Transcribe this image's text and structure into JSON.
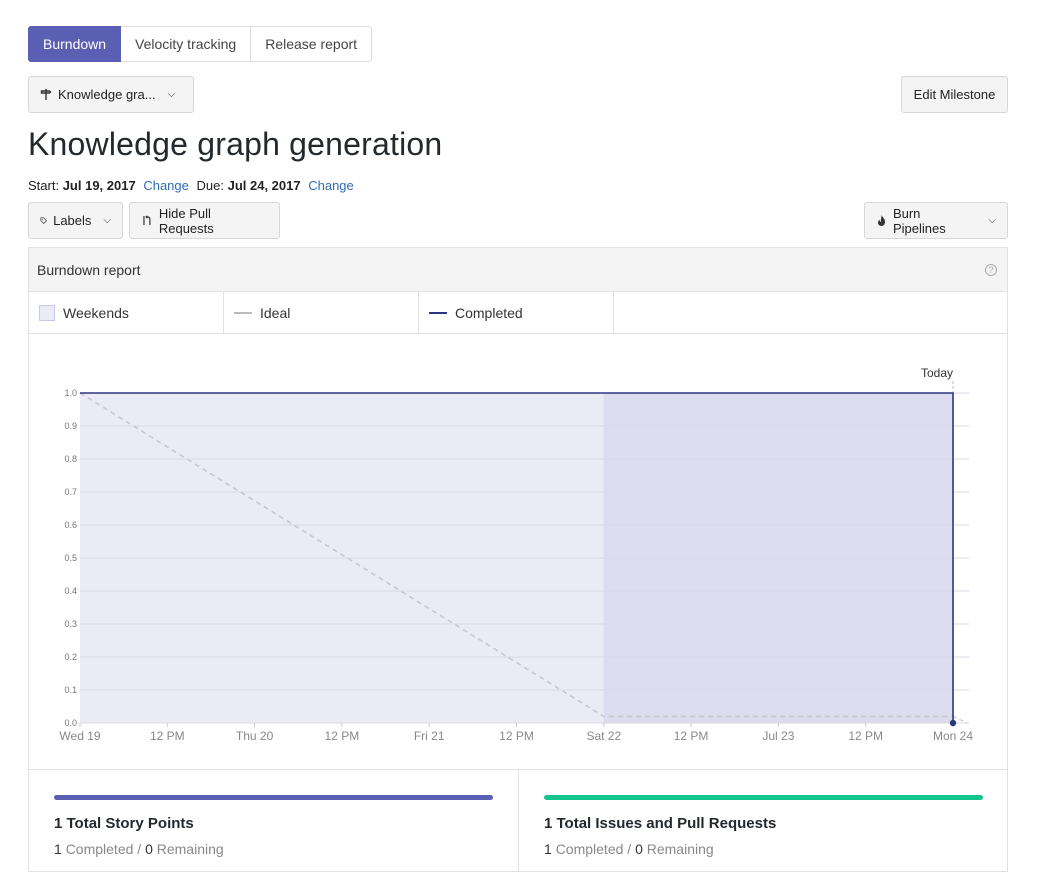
{
  "tabs": [
    {
      "label": "Burndown",
      "active": true
    },
    {
      "label": "Velocity tracking",
      "active": false
    },
    {
      "label": "Release report",
      "active": false
    }
  ],
  "milestone_select": {
    "icon": "milestone-icon",
    "label": "Knowledge gra..."
  },
  "edit_milestone_label": "Edit Milestone",
  "page_title": "Knowledge graph generation",
  "dates": {
    "start_label": "Start:",
    "start_value": "Jul 19, 2017",
    "due_label": "Due:",
    "due_value": "Jul 24, 2017",
    "change_label": "Change"
  },
  "toolbar": {
    "labels_label": "Labels",
    "hide_prs_label": "Hide Pull Requests",
    "burn_pipelines_label": "Burn Pipelines"
  },
  "report": {
    "title": "Burndown report",
    "help_glyph": "?",
    "legend": [
      "Weekends",
      "Ideal",
      "Completed"
    ]
  },
  "colors": {
    "accent": "#5b5fb4",
    "completed_line": "#2e3580",
    "ideal_line": "#c8c8cc",
    "weekday_fill": "#ebebf6",
    "weekend_fill": "#dcdcee",
    "issues_bar": "#12c48b"
  },
  "chart_data": {
    "type": "line",
    "x_ticks": [
      "Wed 19",
      "12 PM",
      "Thu 20",
      "12 PM",
      "Fri 21",
      "12 PM",
      "Sat 22",
      "12 PM",
      "Jul 23",
      "12 PM",
      "Mon 24"
    ],
    "y_ticks": [
      "0.0",
      "0.1",
      "0.2",
      "0.3",
      "0.4",
      "0.5",
      "0.6",
      "0.7",
      "0.8",
      "0.9",
      "1.0"
    ],
    "ylim": [
      0,
      1
    ],
    "x_unit": "days from Wed 19 (0 = Wed 19, 5 = Mon 24)",
    "xlim": [
      0,
      5
    ],
    "today_label": "Today",
    "today_x": 5,
    "weekend_range": [
      3,
      5
    ],
    "series": [
      {
        "name": "Ideal",
        "points": [
          [
            0,
            1.0
          ],
          [
            3,
            0.02
          ],
          [
            5,
            0.02
          ]
        ]
      },
      {
        "name": "Completed",
        "points": [
          [
            0,
            1.0
          ],
          [
            5,
            1.0
          ],
          [
            5,
            0.0
          ]
        ]
      }
    ]
  },
  "stats": [
    {
      "title": "1 Total Story Points",
      "completed": "1",
      "completed_label": "Completed /",
      "remaining": "0",
      "remaining_label": "Remaining",
      "color": "#5b5fb4"
    },
    {
      "title": "1 Total Issues and Pull Requests",
      "completed": "1",
      "completed_label": "Completed /",
      "remaining": "0",
      "remaining_label": "Remaining",
      "color": "#12c48b"
    }
  ]
}
